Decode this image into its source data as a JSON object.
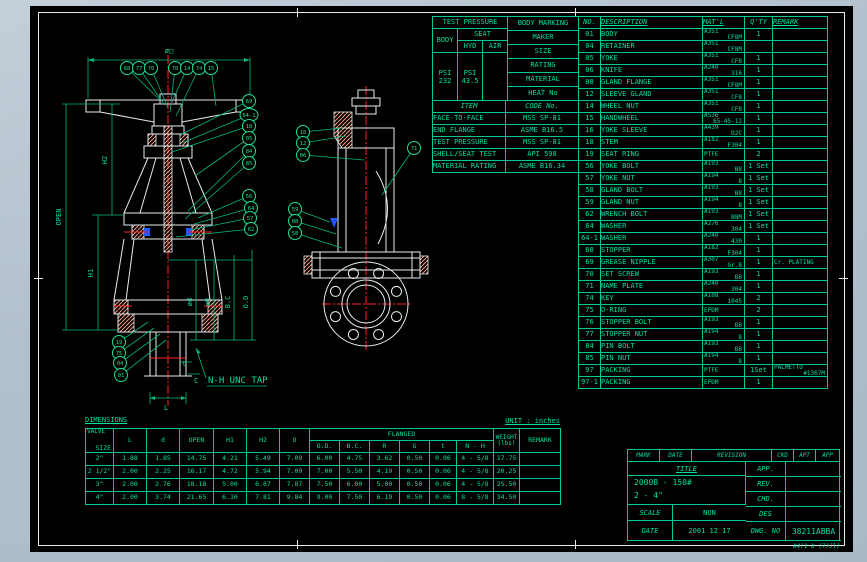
{
  "tables": {
    "test_pressure": {
      "title": "TEST PRESSURE",
      "body": "BODY",
      "seat": "SEAT",
      "hyd": "HYD",
      "air": "AIR",
      "psi": "PSI",
      "body_value": "232",
      "hyd_value": "43.5",
      "air_value": ""
    },
    "body_marking": {
      "title": "BODY MARKING",
      "items": [
        "MAKER",
        "SIZE",
        "RATING",
        "MATERIAL",
        "HEAT No"
      ]
    },
    "codes": {
      "item_header": "ITEM",
      "code_header": "CODE No.",
      "rows": [
        [
          "FACE-TO-FACE",
          "MSS SP-81"
        ],
        [
          "END FLANGE",
          "ASME B16.5"
        ],
        [
          "TEST PRESSURE",
          "MSS SP-81"
        ],
        [
          "SHELL/SEAT TEST",
          "API 598"
        ],
        [
          "MATERIAL RATING",
          "ASME B16.34"
        ]
      ]
    },
    "parts": {
      "headers": [
        "NO.",
        "DESCRIPTION",
        "MAT'L",
        "Q'TY",
        "REMARK"
      ],
      "rows": [
        [
          "01",
          "BODY",
          "A351|CF8M",
          "1",
          ""
        ],
        [
          "04",
          "RETAINER",
          "A351|CF8M",
          "",
          ""
        ],
        [
          "05",
          "YOKE",
          "A351|CF8",
          "1",
          ""
        ],
        [
          "06",
          "KNIFE",
          "A240|316",
          "1",
          ""
        ],
        [
          "08",
          "GLAND FLANGE",
          "A351|CF8M",
          "1",
          ""
        ],
        [
          "12",
          "SLEEVE GLAND",
          "A351|CF8",
          "1",
          ""
        ],
        [
          "14",
          "WHEEL NUT",
          "A351|CF8",
          "1",
          ""
        ],
        [
          "15",
          "HANDWHEEL",
          "A536|65-45-12",
          "1",
          ""
        ],
        [
          "16",
          "YOKE SLEEVE",
          "A439|D2C",
          "1",
          ""
        ],
        [
          "18",
          "STEM",
          "A182|F304",
          "1",
          ""
        ],
        [
          "19",
          "SEAT RING",
          "PTFE",
          "2",
          ""
        ],
        [
          "56",
          "YOKE BOLT",
          "A193|B8",
          "1 Set",
          ""
        ],
        [
          "57",
          "YOKE NUT",
          "A194|8",
          "1 Set",
          ""
        ],
        [
          "58",
          "GLAND BOLT",
          "A193|B8",
          "1 Set",
          ""
        ],
        [
          "59",
          "GLAND NUT",
          "A194|8",
          "1 Set",
          ""
        ],
        [
          "62",
          "WRENCH BOLT",
          "A193|B8M",
          "1 Set",
          ""
        ],
        [
          "64",
          "WASHER",
          "A276|304",
          "1 Set",
          ""
        ],
        [
          "64-1",
          "WASHER",
          "A240|430",
          "1",
          ""
        ],
        [
          "68",
          "STOPPER",
          "A182|F304",
          "1",
          ""
        ],
        [
          "69",
          "GREASE NIPPLE",
          "A307|Gr.B",
          "1",
          "Cr. PLATING"
        ],
        [
          "70",
          "SET SCREW",
          "A193|B8",
          "1",
          ""
        ],
        [
          "71",
          "NAME PLATE",
          "A240|304",
          "1",
          ""
        ],
        [
          "74",
          "KEY",
          "A108|1045",
          "2",
          ""
        ],
        [
          "75",
          "O-RING",
          "EPDM",
          "2",
          ""
        ],
        [
          "76",
          "STOPPER BOLT",
          "A193|B8",
          "1",
          ""
        ],
        [
          "77",
          "STOPPER NUT",
          "A194|8",
          "1",
          ""
        ],
        [
          "84",
          "PIN BOLT",
          "A193|B8",
          "1",
          ""
        ],
        [
          "85",
          "PIN NUT",
          "A194|8",
          "1",
          ""
        ],
        [
          "97",
          "PACKING",
          "PTFE",
          "1Set",
          "PALMETTO|#1367M"
        ],
        [
          "97-1",
          "PACKING",
          "EPDM",
          "1",
          ""
        ]
      ]
    },
    "dimensions": {
      "label": "DIMENSIONS",
      "unit": "UNIT : inches",
      "valve_1": "VALVE",
      "valve_2": "SIZE",
      "cols": [
        "L",
        "d",
        "OPEN",
        "H1",
        "H2",
        "O"
      ],
      "flanged": "FLANGED",
      "flanged_cols": [
        "O.D.",
        "B.C.",
        "R",
        "G",
        "t",
        "N - H"
      ],
      "weight_1": "WEIGHT",
      "weight_2": "(lbs)",
      "remark": "REMARK",
      "rows": [
        [
          "2\"",
          "1.88",
          "1.85",
          "14.75",
          "4.21",
          "5.49",
          "7.09",
          "6.00",
          "4.75",
          "3.62",
          "0.50",
          "0.06",
          "4 - 5/8",
          "17.75",
          ""
        ],
        [
          "2 1/2\"",
          "2.00",
          "2.25",
          "16.17",
          "4.72",
          "5.94",
          "7.09",
          "7.00",
          "5.50",
          "4.19",
          "0.50",
          "0.06",
          "4 - 5/8",
          "20.25",
          ""
        ],
        [
          "3\"",
          "2.00",
          "2.76",
          "18.18",
          "5.00",
          "6.67",
          "7.87",
          "7.50",
          "6.00",
          "5.00",
          "0.50",
          "0.06",
          "4 - 5/8",
          "25.50",
          ""
        ],
        [
          "4\"",
          "2.00",
          "3.74",
          "21.65",
          "6.10",
          "7.81",
          "9.84",
          "9.00",
          "7.50",
          "6.19",
          "0.50",
          "0.06",
          "8 - 5/8",
          "34.50",
          ""
        ]
      ]
    }
  },
  "title_block": {
    "header": [
      "MARK",
      "DATE",
      "REVISION",
      "CKD",
      "APT",
      "APP"
    ],
    "title_label": "TITLE",
    "title_line1": "2000B - 150#",
    "title_line2": "2 - 4\"",
    "right_labels": [
      "APP.",
      "REV.",
      "CHD.",
      "DES"
    ],
    "scale_label": "SCALE",
    "scale_value": "NON",
    "date_label": "DATE",
    "date_value": "2001 12 17",
    "dwg_label": "DWG. NO",
    "dwg_value": "38211ABBA",
    "sheet_note": "A4(1 b (7)Jl)"
  },
  "drawing": {
    "balloons": {
      "68": "68",
      "77": "77",
      "76": "76",
      "70": "70",
      "14": "14",
      "74": "74",
      "15": "15",
      "69": "69",
      "64-1": "64-1",
      "18": "18",
      "05": "05",
      "84": "84",
      "85": "85",
      "56": "56",
      "64": "64",
      "57": "57",
      "62": "62",
      "19": "19",
      "75": "75",
      "04": "04",
      "01": "01",
      "16": "16",
      "12": "12",
      "06": "06",
      "71": "71",
      "59": "59",
      "08": "08",
      "58": "58"
    },
    "labels": {
      "dia_d": "ø□",
      "open": "OPEN",
      "h2": "H2",
      "h1": "H1",
      "small_d": "ød",
      "r_dim": "øR",
      "bc": "B.C",
      "od": "O.D",
      "t": "t",
      "c": "C",
      "l": "L",
      "tap": "N-H UNC TAP"
    }
  }
}
